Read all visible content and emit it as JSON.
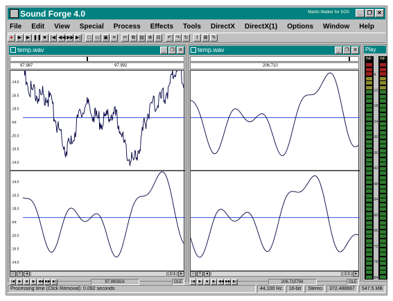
{
  "app": {
    "title": "Sound Forge 4.0",
    "registered_to": "Martin Walker for SOS",
    "accent_color": "#008080",
    "waveform_color": "#000040",
    "center_line_color": "#3050d0"
  },
  "window_controls": {
    "minimize": "_",
    "restore": "❐",
    "close": "✕"
  },
  "menu": [
    "File",
    "Edit",
    "View",
    "Special",
    "Process",
    "Effects",
    "Tools",
    "DirectX",
    "DirectX(1)",
    "Options",
    "Window",
    "Help"
  ],
  "toolbar": {
    "icons": [
      "record-icon",
      "play-all-icon",
      "play-icon",
      "pause-icon",
      "stop-icon",
      "go-start-icon",
      "rewind-icon",
      "forward-icon",
      "go-end-icon",
      "new-icon",
      "open-icon",
      "save-icon",
      "properties-icon",
      "cut-icon",
      "copy-icon",
      "paste-icon",
      "mix-icon",
      "trim-icon",
      "undo-icon",
      "redo-icon",
      "repeat-icon",
      "edit-tool-icon",
      "magnify-tool-icon",
      "pencil-tool-icon"
    ],
    "glyphs": [
      "●",
      "▶",
      "▶",
      "❚❚",
      "■",
      "|◀",
      "◀◀",
      "▶▶",
      "▶|",
      "□",
      "▭",
      "▣",
      "≡",
      "✂",
      "⧉",
      "▤",
      "⊕",
      "⊟",
      "↶",
      "↷",
      "↻",
      "I",
      "⊠",
      "✎"
    ]
  },
  "docs": [
    {
      "title": "temp.wav",
      "ruler_labels": [
        "97.987",
        "97.992"
      ],
      "amplitude_labels_top": [
        "-14.0",
        "-16.5",
        "-18.0",
        "-Inf.",
        "-20.0",
        "-16.5",
        "-14.0"
      ],
      "amplitude_labels_bottom": [
        "-14.0",
        "-16.5",
        "-18.0",
        "-Inf.",
        "-20.0",
        "-16.5",
        "-14.0"
      ],
      "zoom": "1:1",
      "position": "97.990816",
      "ole_label": "OLE"
    },
    {
      "title": "temp.wav",
      "ruler_labels": [
        "206.710"
      ],
      "amplitude_labels_top": [],
      "amplitude_labels_bottom": [],
      "zoom": "1:1",
      "position": "206.710794",
      "ole_label": "OLE"
    }
  ],
  "play_meter": {
    "title": "Play",
    "channel_labels": [
      "INF.",
      "INF."
    ],
    "scale": [
      "-6",
      "-12",
      "-18",
      "-24",
      "-30",
      "-36",
      "-42",
      "-48",
      "-54",
      "-60",
      "-66",
      "-72",
      "-78",
      "-84"
    ]
  },
  "status": {
    "message": "Processing time (Click Removal): 0.092 seconds",
    "sample_rate": "44,100 Hz",
    "bit_depth": "16-bit",
    "channels": "Stereo",
    "length": "372.488667",
    "disk_free": "547.5 MB"
  }
}
